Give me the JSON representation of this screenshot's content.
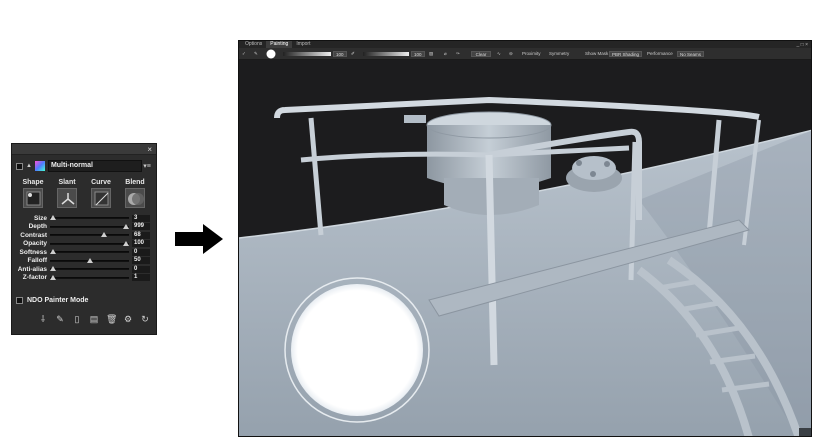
{
  "panel": {
    "preset_name": "Multi-normal",
    "close_glyph": "×",
    "tools": [
      {
        "label": "Shape",
        "icon": "shape-icon"
      },
      {
        "label": "Slant",
        "icon": "slant-icon"
      },
      {
        "label": "Curve",
        "icon": "curve-icon"
      },
      {
        "label": "Blend",
        "icon": "blend-icon"
      }
    ],
    "sliders": [
      {
        "label": "Size",
        "value": "3",
        "level": 0.03
      },
      {
        "label": "Depth",
        "value": "999",
        "level": 1.0
      },
      {
        "label": "Contrast",
        "value": "68",
        "level": 0.68
      },
      {
        "label": "Opacity",
        "value": "100",
        "level": 1.0
      },
      {
        "label": "Softness",
        "value": "0",
        "level": 0.0
      },
      {
        "label": "Falloff",
        "value": "50",
        "level": 0.5
      },
      {
        "label": "Anti-alias",
        "value": "0",
        "level": 0.0
      },
      {
        "label": "Z-factor",
        "value": "1",
        "level": 0.01
      }
    ],
    "ndo_label": "NDO Painter Mode",
    "bottom_icons": [
      "brush-picker-icon",
      "material-icon",
      "new-doc-icon",
      "save-doc-icon",
      "delete-icon",
      "settings-icon",
      "refresh-icon"
    ]
  },
  "app": {
    "tabs": [
      "Options",
      "Painting",
      "Import"
    ],
    "active_tab": "Painting",
    "window_controls": "_ □ ×",
    "toolbar": {
      "size_value": "100",
      "opacity_value": "100",
      "clear_label": "Clear",
      "proximity_label": "Proximity",
      "symmetry_label": "Symmetry",
      "show_mask_label": "Show Mask",
      "shading_label": "PBR Shading",
      "performance_label": "Performance",
      "no_seams_label": "No Seams"
    }
  },
  "colors": {
    "panel_bg": "#2c2c2c",
    "viewport_sky": "#1c1c1c",
    "model_surface": "#a9b4bf"
  }
}
